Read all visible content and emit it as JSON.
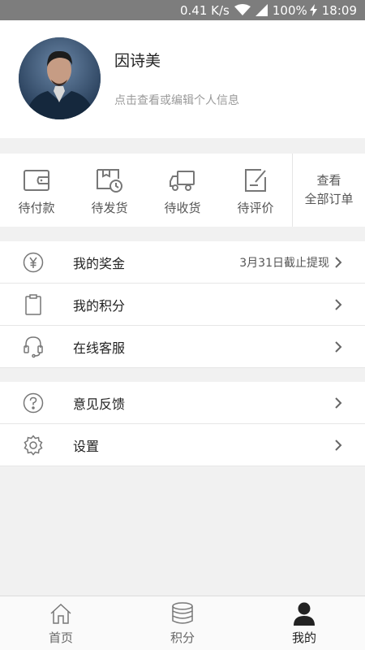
{
  "status_bar": {
    "speed": "0.41 K/s",
    "battery": "100%",
    "time": "18:09"
  },
  "profile": {
    "name": "因诗美",
    "hint": "点击查看或编辑个人信息"
  },
  "orders": {
    "items": [
      {
        "label": "待付款",
        "icon": "wallet-icon"
      },
      {
        "label": "待发货",
        "icon": "package-clock-icon"
      },
      {
        "label": "待收货",
        "icon": "truck-icon"
      },
      {
        "label": "待评价",
        "icon": "review-icon"
      }
    ],
    "all": {
      "line1": "查看",
      "line2": "全部订单"
    }
  },
  "menu": {
    "bonus": {
      "label": "我的奖金",
      "value": "3月31日截止提现",
      "icon": "yuan-icon"
    },
    "points": {
      "label": "我的积分",
      "icon": "clipboard-icon"
    },
    "service": {
      "label": "在线客服",
      "icon": "headset-icon"
    },
    "feedback": {
      "label": "意见反馈",
      "icon": "question-icon"
    },
    "settings": {
      "label": "设置",
      "icon": "gear-icon"
    }
  },
  "tabbar": {
    "items": [
      {
        "label": "首页",
        "icon": "home-icon"
      },
      {
        "label": "积分",
        "icon": "coins-icon"
      },
      {
        "label": "我的",
        "icon": "person-icon",
        "active": true
      }
    ]
  },
  "colors": {
    "background": "#f1f1f1",
    "status_bar": "#7d7d7d",
    "icon_gray": "#888888"
  }
}
